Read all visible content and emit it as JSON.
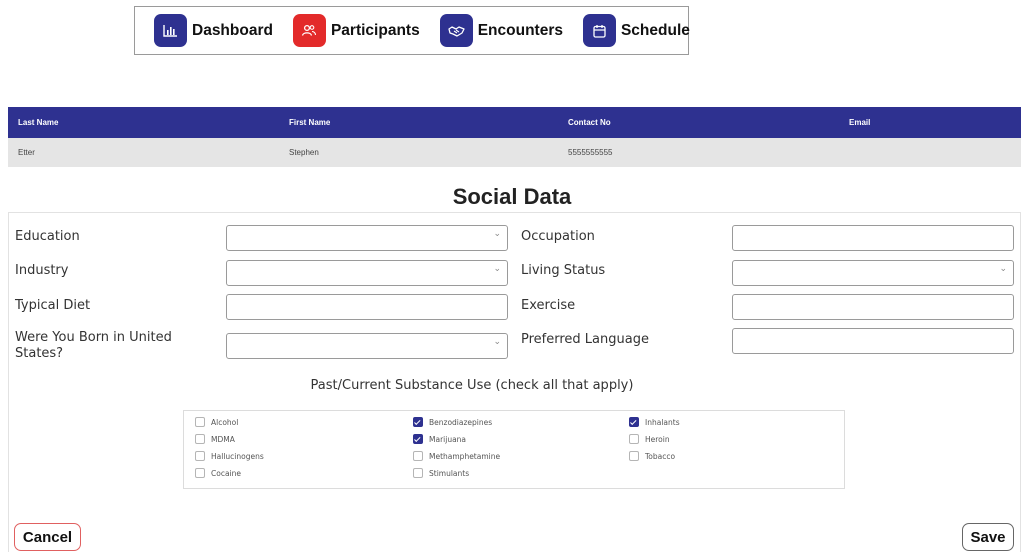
{
  "nav": {
    "items": [
      {
        "label": "Dashboard",
        "icon": "chart-icon",
        "color": "#2e3190"
      },
      {
        "label": "Participants",
        "icon": "people-icon",
        "color": "#e32a2a"
      },
      {
        "label": "Encounters",
        "icon": "handshake-icon",
        "color": "#2e3190"
      },
      {
        "label": "Schedule",
        "icon": "calendar-icon",
        "color": "#2e3190"
      }
    ]
  },
  "participant": {
    "headers": [
      "Last Name",
      "First Name",
      "Contact No",
      "Email"
    ],
    "row": [
      "Etter",
      "Stephen",
      "5555555555",
      ""
    ]
  },
  "form": {
    "title": "Social Data",
    "education": {
      "label": "Education",
      "value": ""
    },
    "occupation": {
      "label": "Occupation",
      "value": ""
    },
    "industry": {
      "label": "Industry",
      "value": ""
    },
    "living_status": {
      "label": "Living Status",
      "value": ""
    },
    "typical_diet": {
      "label": "Typical Diet",
      "value": ""
    },
    "exercise": {
      "label": "Exercise",
      "value": ""
    },
    "born_us": {
      "label": "Were You Born in United States?",
      "value": ""
    },
    "preferred_language": {
      "label": "Preferred Language",
      "value": ""
    },
    "substance_title": "Past/Current Substance Use (check all that apply)",
    "substances": [
      {
        "label": "Alcohol",
        "checked": false
      },
      {
        "label": "Benzodiazepines",
        "checked": true
      },
      {
        "label": "Inhalants",
        "checked": true
      },
      {
        "label": "MDMA",
        "checked": false
      },
      {
        "label": "Marijuana",
        "checked": true
      },
      {
        "label": "Heroin",
        "checked": false
      },
      {
        "label": "Hallucinogens",
        "checked": false
      },
      {
        "label": "Methamphetamine",
        "checked": false
      },
      {
        "label": "Tobacco",
        "checked": false
      },
      {
        "label": "Cocaine",
        "checked": false
      },
      {
        "label": "Stimulants",
        "checked": false
      }
    ],
    "cancel_label": "Cancel",
    "save_label": "Save"
  },
  "colors": {
    "primary": "#2e3190",
    "danger": "#e32a2a",
    "row_bg": "#e5e5e5"
  }
}
